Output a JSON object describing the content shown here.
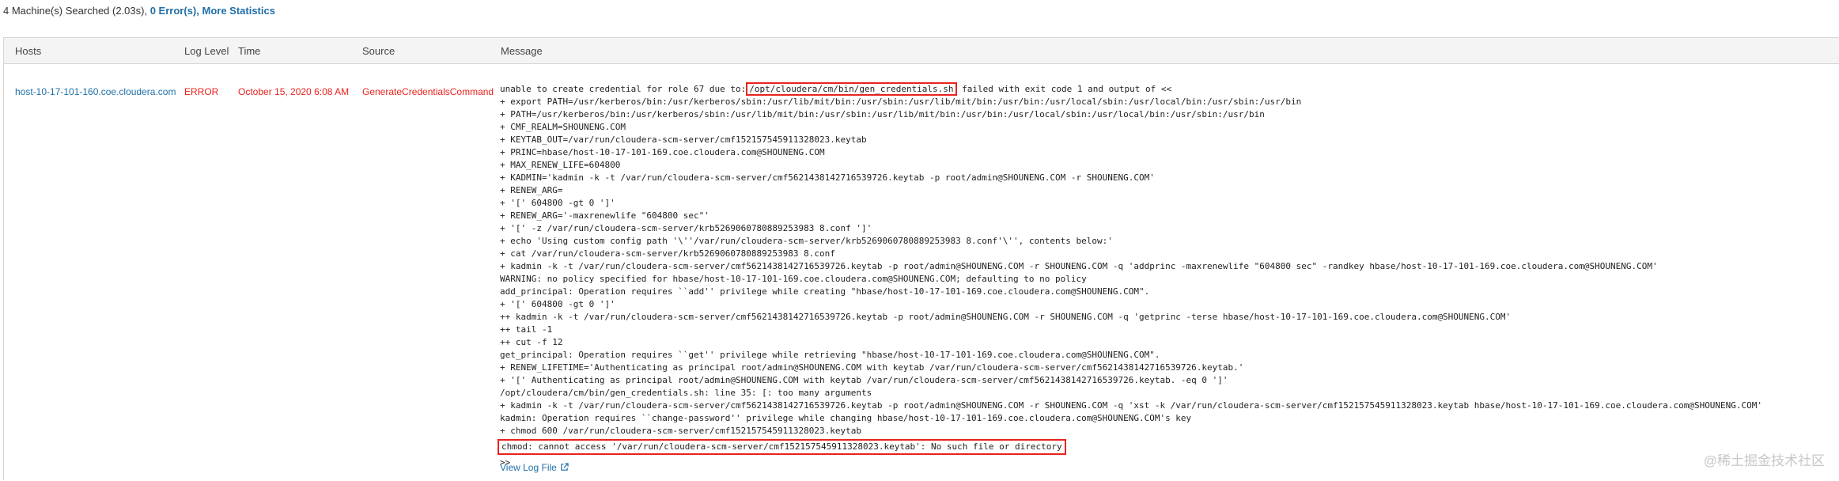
{
  "summary": {
    "searched": "4 Machine(s) Searched (2.03s),",
    "errors": "0 Error(s),",
    "more": "More Statistics"
  },
  "table": {
    "headers": {
      "hosts": "Hosts",
      "log_level": "Log Level",
      "time": "Time",
      "source": "Source",
      "message": "Message"
    },
    "row": {
      "host": "host-10-17-101-160.coe.cloudera.com",
      "level": "ERROR",
      "time": "October 15, 2020 6:08 AM",
      "source": "GenerateCredentialsCommand",
      "message_first_prefix": "unable to create credential for role 67 due to:",
      "message_first_highlight": "/opt/cloudera/cm/bin/gen_credentials.sh",
      "message_first_suffix": " failed with exit code 1 and output of <<",
      "message_lines": [
        "+ export PATH=/usr/kerberos/bin:/usr/kerberos/sbin:/usr/lib/mit/bin:/usr/sbin:/usr/lib/mit/bin:/usr/bin:/usr/local/sbin:/usr/local/bin:/usr/sbin:/usr/bin",
        "+ PATH=/usr/kerberos/bin:/usr/kerberos/sbin:/usr/lib/mit/bin:/usr/sbin:/usr/lib/mit/bin:/usr/bin:/usr/local/sbin:/usr/local/bin:/usr/sbin:/usr/bin",
        "+ CMF_REALM=SHOUNENG.COM",
        "+ KEYTAB_OUT=/var/run/cloudera-scm-server/cmf152157545911328023.keytab",
        "+ PRINC=hbase/host-10-17-101-169.coe.cloudera.com@SHOUNENG.COM",
        "+ MAX_RENEW_LIFE=604800",
        "+ KADMIN='kadmin -k -t /var/run/cloudera-scm-server/cmf5621438142716539726.keytab -p root/admin@SHOUNENG.COM -r SHOUNENG.COM'",
        "+ RENEW_ARG=",
        "+ '[' 604800 -gt 0 ']'",
        "+ RENEW_ARG='-maxrenewlife \"604800 sec\"'",
        "+ '[' -z /var/run/cloudera-scm-server/krb5269060780889253983 8.conf ']'",
        "+ echo 'Using custom config path '\\''/var/run/cloudera-scm-server/krb5269060780889253983 8.conf'\\'', contents below:'",
        "+ cat /var/run/cloudera-scm-server/krb5269060780889253983 8.conf",
        "+ kadmin -k -t /var/run/cloudera-scm-server/cmf5621438142716539726.keytab -p root/admin@SHOUNENG.COM -r SHOUNENG.COM -q 'addprinc -maxrenewlife \"604800 sec\" -randkey hbase/host-10-17-101-169.coe.cloudera.com@SHOUNENG.COM'",
        "WARNING: no policy specified for hbase/host-10-17-101-169.coe.cloudera.com@SHOUNENG.COM; defaulting to no policy",
        "add_principal: Operation requires ``add'' privilege while creating \"hbase/host-10-17-101-169.coe.cloudera.com@SHOUNENG.COM\".",
        "+ '[' 604800 -gt 0 ']'",
        "++ kadmin -k -t /var/run/cloudera-scm-server/cmf5621438142716539726.keytab -p root/admin@SHOUNENG.COM -r SHOUNENG.COM -q 'getprinc -terse hbase/host-10-17-101-169.coe.cloudera.com@SHOUNENG.COM'",
        "++ tail -1",
        "++ cut -f 12",
        "get_principal: Operation requires ``get'' privilege while retrieving \"hbase/host-10-17-101-169.coe.cloudera.com@SHOUNENG.COM\".",
        "+ RENEW_LIFETIME='Authenticating as principal root/admin@SHOUNENG.COM with keytab /var/run/cloudera-scm-server/cmf5621438142716539726.keytab.'",
        "+ '[' Authenticating as principal root/admin@SHOUNENG.COM with keytab /var/run/cloudera-scm-server/cmf5621438142716539726.keytab. -eq 0 ']'",
        "/opt/cloudera/cm/bin/gen_credentials.sh: line 35: [: too many arguments",
        "+ kadmin -k -t /var/run/cloudera-scm-server/cmf5621438142716539726.keytab -p root/admin@SHOUNENG.COM -r SHOUNENG.COM -q 'xst -k /var/run/cloudera-scm-server/cmf152157545911328023.keytab hbase/host-10-17-101-169.coe.cloudera.com@SHOUNENG.COM'",
        "kadmin: Operation requires ``change-password'' privilege while changing hbase/host-10-17-101-169.coe.cloudera.com@SHOUNENG.COM's key",
        "+ chmod 600 /var/run/cloudera-scm-server/cmf152157545911328023.keytab"
      ],
      "message_error_line": "chmod: cannot access '/var/run/cloudera-scm-server/cmf152157545911328023.keytab': No such file or directory",
      "message_end": ">>",
      "view_log_file": "View Log File"
    }
  },
  "watermark": "@稀土掘金技术社区",
  "colors": {
    "link": "#1f6fa8",
    "error": "#e8231e",
    "header_bg": "#f4f4f4",
    "border": "#d6d6d6"
  },
  "icons": {
    "view_log_file": "external-link-icon"
  }
}
